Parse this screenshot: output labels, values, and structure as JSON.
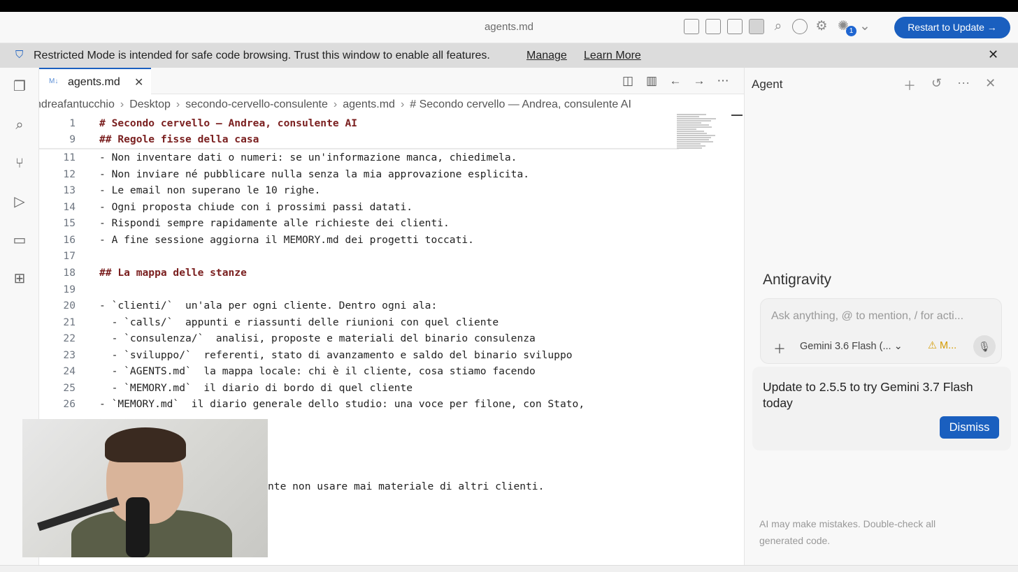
{
  "window": {
    "title": "agents.md",
    "update_button": "Restart to Update →",
    "notif_count": "1"
  },
  "restricted_banner": {
    "message": "Restricted Mode is intended for safe code browsing. Trust this window to enable all features.",
    "manage": "Manage",
    "learn_more": "Learn More"
  },
  "tab": {
    "icon": "M↓",
    "name": "agents.md"
  },
  "breadcrumb": {
    "items": [
      "ndreafantucchio",
      "Desktop",
      "secondo-cervello-consulente",
      "agents.md",
      "# Secondo cervello — Andrea, consulente AI"
    ]
  },
  "code_lines": [
    {
      "n": "1",
      "text": "# Secondo cervello — Andrea, consulente AI",
      "heading": true
    },
    {
      "n": "9",
      "text": "## Regole fisse della casa",
      "heading": true
    },
    {
      "n": "11",
      "text": "- Non inventare dati o numeri: se un'informazione manca, chiedimela.",
      "heading": false
    },
    {
      "n": "12",
      "text": "- Non inviare né pubblicare nulla senza la mia approvazione esplicita.",
      "heading": false
    },
    {
      "n": "13",
      "text": "- Le email non superano le 10 righe.",
      "heading": false
    },
    {
      "n": "14",
      "text": "- Ogni proposta chiude con i prossimi passi datati.",
      "heading": false
    },
    {
      "n": "15",
      "text": "- Rispondi sempre rapidamente alle richieste dei clienti.",
      "heading": false
    },
    {
      "n": "16",
      "text": "- A fine sessione aggiorna il MEMORY.md dei progetti toccati.",
      "heading": false
    },
    {
      "n": "17",
      "text": "",
      "heading": false
    },
    {
      "n": "18",
      "text": "## La mappa delle stanze",
      "heading": true
    },
    {
      "n": "19",
      "text": "",
      "heading": false
    },
    {
      "n": "20",
      "text": "- `clienti/` ⁠ un'ala per ogni cliente. Dentro ogni ala:",
      "heading": false
    },
    {
      "n": "21",
      "text": "  - `calls/` ⁠ appunti e riassunti delle riunioni con quel cliente",
      "heading": false
    },
    {
      "n": "22",
      "text": "  - `consulenza/` ⁠ analisi, proposte e materiali del binario consulenza",
      "heading": false
    },
    {
      "n": "23",
      "text": "  - `sviluppo/` ⁠ referenti, stato di avanzamento e saldo del binario sviluppo",
      "heading": false
    },
    {
      "n": "24",
      "text": "  - `AGENTS.md` ⁠ la mappa locale: chi è il cliente, cosa stiamo facendo",
      "heading": false
    },
    {
      "n": "25",
      "text": "  - `MEMORY.md` ⁠ il diario di bordo di quel cliente",
      "heading": false
    },
    {
      "n": "26",
      "text": "- `MEMORY.md` ⁠ il diario generale dello studio: una voce per filone, con Stato,",
      "heading": false
    }
  ],
  "partial_line": "nte non usare mai materiale di altri clienti.",
  "agent": {
    "title": "Agent",
    "brand": "Antigravity",
    "input_placeholder": "Ask anything, @ to mention, / for acti...",
    "model": "Gemini 3.6 Flash (...",
    "mode": "M...",
    "update_text": "Update to 2.5.5 to try Gemini 3.7 Flash today",
    "dismiss": "Dismiss",
    "footer": "AI may make mistakes. Double-check all generated code."
  }
}
